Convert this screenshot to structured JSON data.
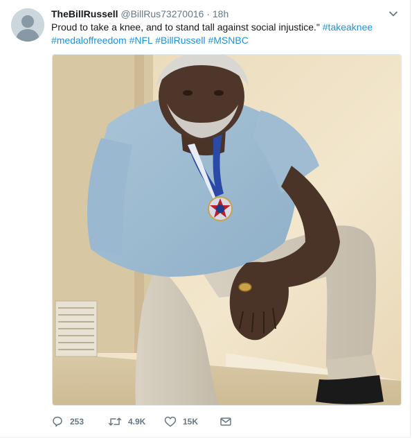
{
  "tweet": {
    "display_name": "TheBillRussell",
    "handle": "@BillRus73270016",
    "separator": "·",
    "time": "18h",
    "text_before": "Proud to take a knee, and to stand tall against social injustice.\"",
    "hashtags": [
      "#takeaknee",
      "#medaloffreedom",
      "#NFL",
      "#BillRussell",
      "#MSNBC"
    ]
  },
  "actions": {
    "replies": "253",
    "retweets": "4.9K",
    "likes": "15K"
  },
  "colors": {
    "link": "#1b95e0",
    "text": "#14171a",
    "secondary": "#657786"
  },
  "icons": [
    "reply-icon",
    "retweet-icon",
    "like-icon",
    "direct-message-icon",
    "chevron-down-icon",
    "default-avatar-icon"
  ]
}
